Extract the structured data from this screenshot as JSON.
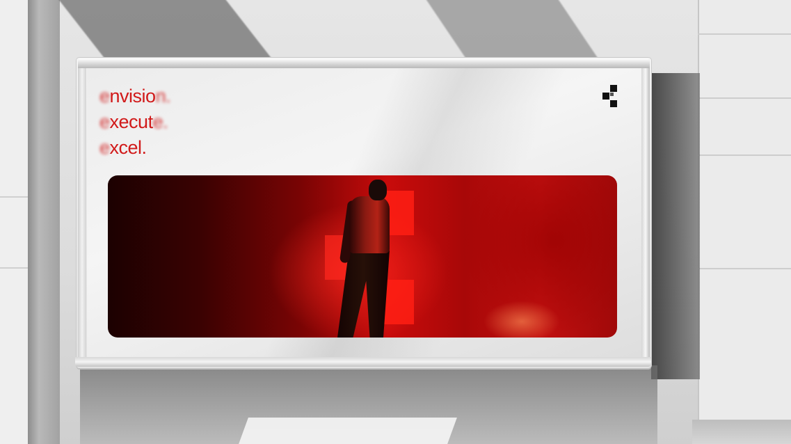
{
  "poster": {
    "headline": [
      {
        "lead": "e",
        "core": "nvisio",
        "tail": "n."
      },
      {
        "lead": "e",
        "core": "xecut",
        "tail": "e."
      },
      {
        "lead": "e",
        "core": "xcel.",
        "tail": ""
      }
    ],
    "accent_color": "#d11a1a",
    "logo_icon": "checker-mark-icon"
  },
  "hero": {
    "subject": "figure-in-red-light",
    "colors": [
      "#1c0101",
      "#c80b0b",
      "#ff1e14"
    ]
  }
}
